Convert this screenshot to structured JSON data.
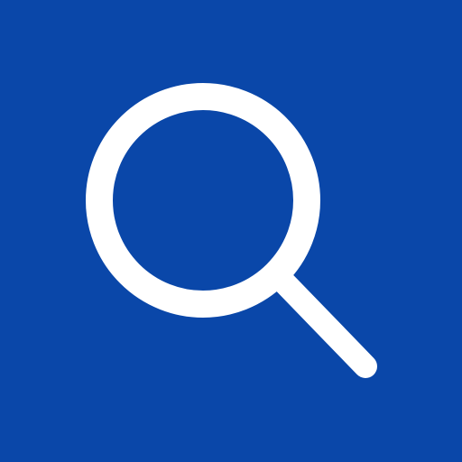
{
  "search_button": {
    "icon": "search-icon",
    "background_color": "#0a47a9",
    "icon_color": "#ffffff"
  }
}
